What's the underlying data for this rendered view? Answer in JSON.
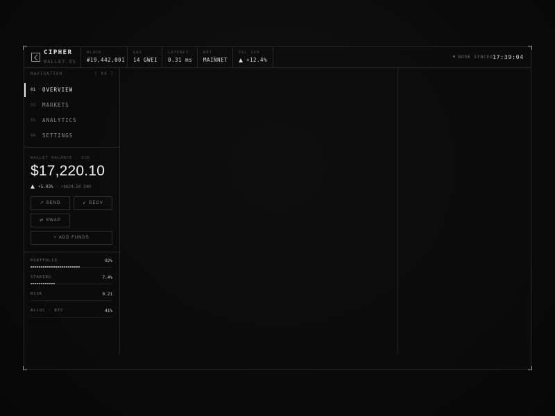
{
  "brand": {
    "name": "CIPHER",
    "sub": "WALLET.OS"
  },
  "header_stats": [
    {
      "label": "BLOCK",
      "value": "#19,442,001"
    },
    {
      "label": "GAS",
      "value": "14 GWEI"
    },
    {
      "label": "LATENCY",
      "value": "0.31 ms"
    },
    {
      "label": "NET",
      "value": "MAINNET"
    },
    {
      "label": "P&L 24H",
      "value": "+12.4%",
      "trend_icon": "triangle-up-icon"
    }
  ],
  "status": {
    "sync_label": "NODE SYNCED",
    "clock": "17:39:04"
  },
  "navigation": {
    "label": "NAVIGATION",
    "count": "[ 04 ]",
    "items": [
      {
        "num": "01",
        "label": "OVERVIEW",
        "active": true
      },
      {
        "num": "02",
        "label": "MARKETS",
        "active": false
      },
      {
        "num": "03",
        "label": "ANALYTICS",
        "active": false
      },
      {
        "num": "04",
        "label": "SETTINGS",
        "active": false
      }
    ]
  },
  "wallet": {
    "label": "WALLET BALANCE · USD",
    "balance": "$17,220.10",
    "change_pct": "+5.03%",
    "separator": "·",
    "change_abs": "+$824.50 24H",
    "actions": {
      "send": {
        "icon": "↗",
        "label": "SEND"
      },
      "recv": {
        "icon": "↙",
        "label": "RECV"
      },
      "swap": {
        "icon": "⇄",
        "label": "SWAP"
      },
      "add": {
        "icon": "+",
        "label": "ADD FUNDS"
      }
    }
  },
  "metrics": [
    {
      "name": "PORTFOLIO",
      "value": "92%",
      "fill": 0.6
    },
    {
      "name": "STAKING",
      "value": "7.4%",
      "fill": 0.3
    },
    {
      "name": "RISK",
      "value": "0.21",
      "fill": null
    },
    {
      "name": "ALLOC · BTC",
      "value": "41%",
      "fill": null
    }
  ],
  "colors": {
    "background": "#0b0b0b",
    "border": "#262626",
    "text": "#e8e8e8",
    "muted": "#555555"
  }
}
